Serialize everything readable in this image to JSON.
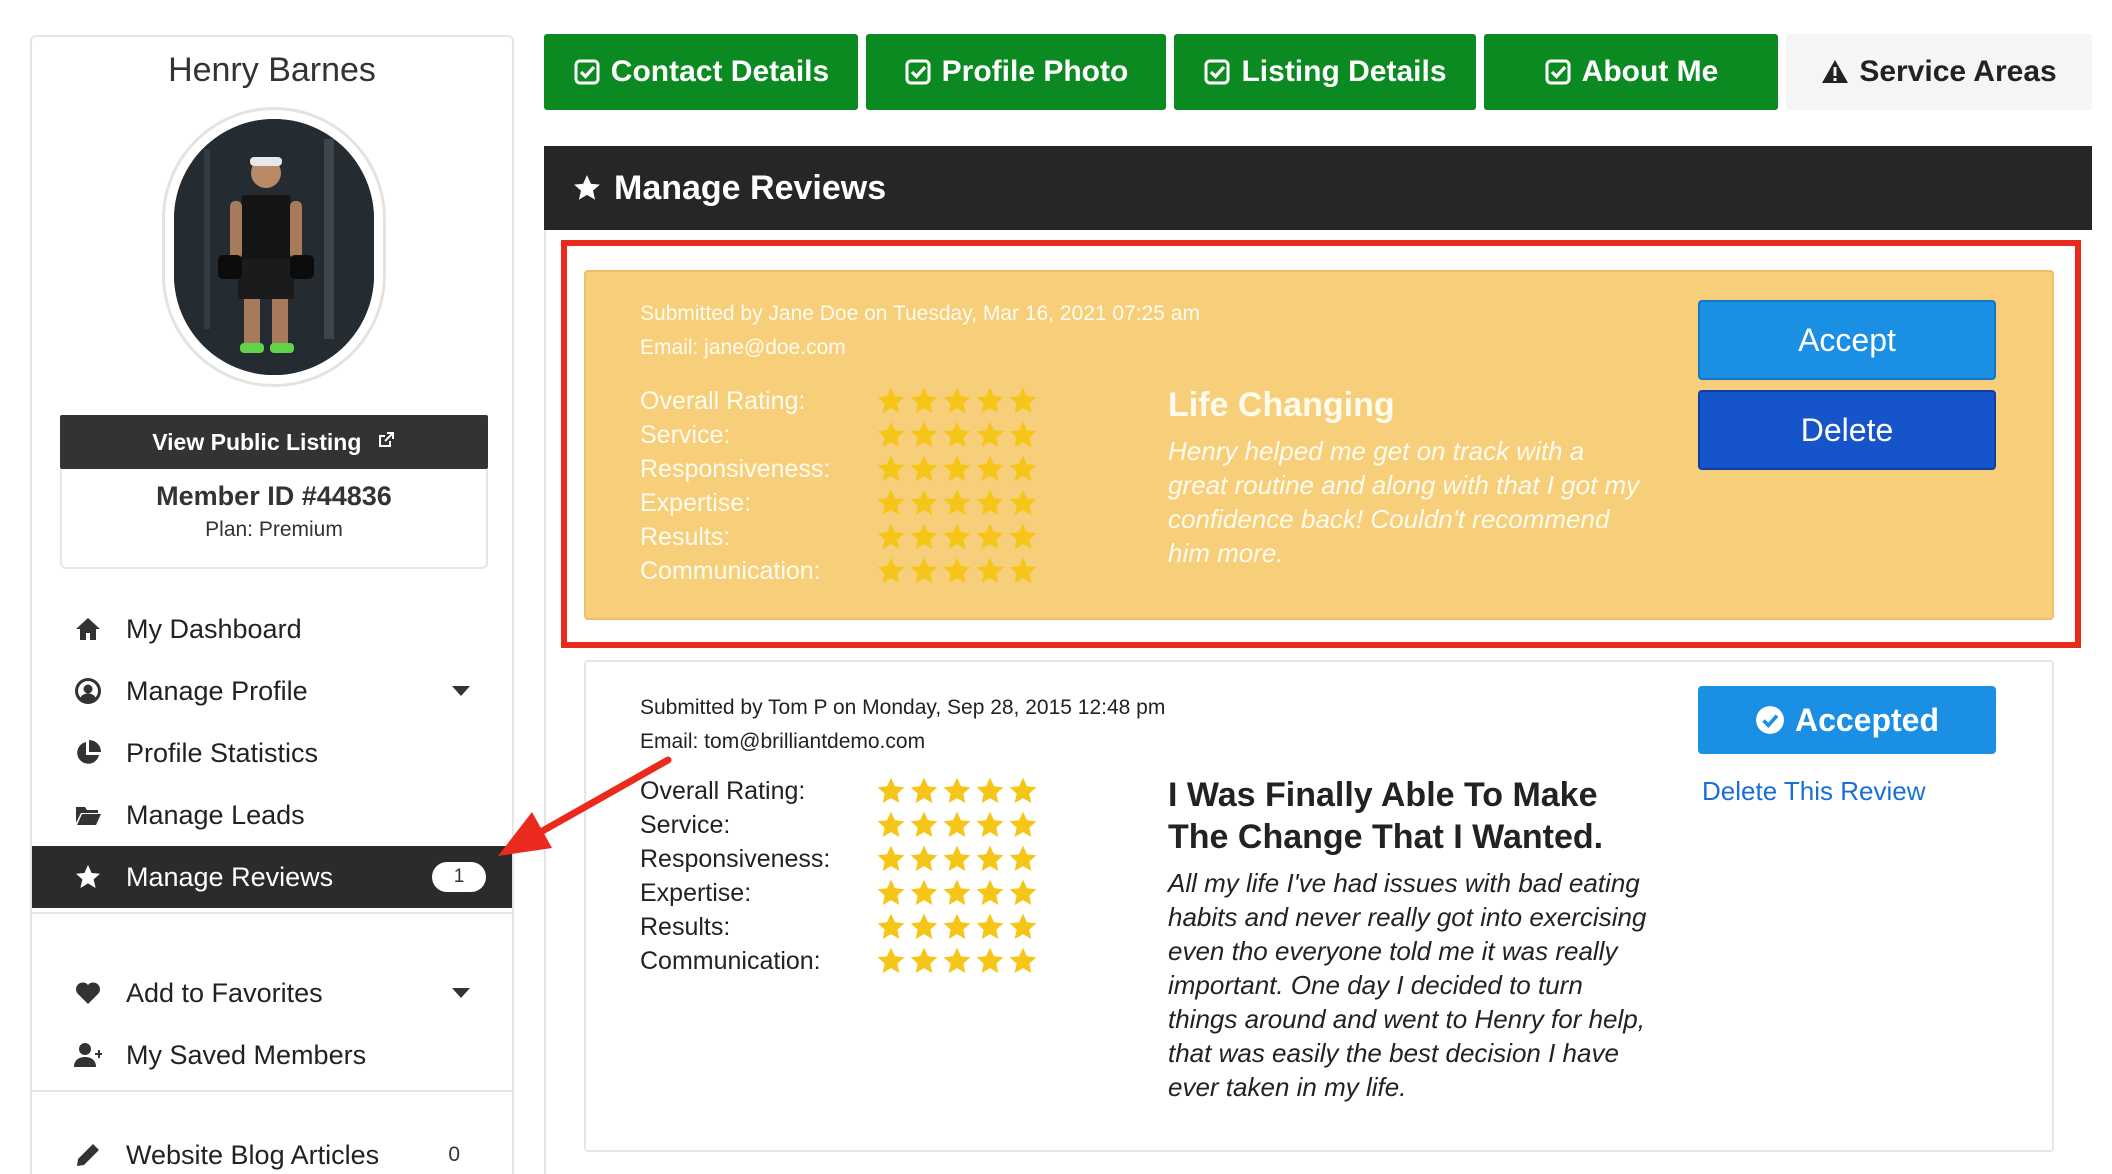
{
  "sidebar": {
    "member_name": "Henry Barnes",
    "view_public_label": "View Public Listing",
    "member_id": "Member ID #44836",
    "plan": "Plan: Premium",
    "nav": [
      {
        "label": "My Dashboard",
        "icon": "home-icon"
      },
      {
        "label": "Manage Profile",
        "icon": "user-circle-icon",
        "dropdown": true
      },
      {
        "label": "Profile Statistics",
        "icon": "pie-chart-icon"
      },
      {
        "label": "Manage Leads",
        "icon": "folder-open-icon"
      },
      {
        "label": "Manage Reviews",
        "icon": "star-icon",
        "badge": "1",
        "active": true
      },
      {
        "label": "Add to Favorites",
        "icon": "heart-icon",
        "dropdown": true
      },
      {
        "label": "My Saved Members",
        "icon": "user-plus-icon"
      },
      {
        "label": "Website Blog Articles",
        "icon": "pencil-icon",
        "count": "0"
      }
    ]
  },
  "tabs": [
    {
      "label": "Contact Details",
      "icon": "check-square-icon",
      "status": "complete"
    },
    {
      "label": "Profile Photo",
      "icon": "check-square-icon",
      "status": "complete"
    },
    {
      "label": "Listing Details",
      "icon": "check-square-icon",
      "status": "complete"
    },
    {
      "label": "About Me",
      "icon": "check-square-icon",
      "status": "complete"
    },
    {
      "label": "Service Areas",
      "icon": "warning-icon",
      "status": "incomplete"
    }
  ],
  "panel": {
    "title": "Manage Reviews"
  },
  "reviews": [
    {
      "status": "pending",
      "submitted": "Submitted by Jane Doe on Tuesday, Mar 16, 2021 07:25 am",
      "email": "Email: jane@doe.com",
      "ratings": [
        {
          "label": "Overall Rating:",
          "stars": 5
        },
        {
          "label": "Service:",
          "stars": 5
        },
        {
          "label": "Responsiveness:",
          "stars": 5
        },
        {
          "label": "Expertise:",
          "stars": 5
        },
        {
          "label": "Results:",
          "stars": 5
        },
        {
          "label": "Communication:",
          "stars": 5
        }
      ],
      "title": "Life Changing",
      "body": "Henry helped me get on track with a great routine and along with that I got my confidence back! Couldn't recommend him more.",
      "accept_label": "Accept",
      "delete_label": "Delete"
    },
    {
      "status": "accepted",
      "submitted": "Submitted by Tom P on Monday, Sep 28, 2015 12:48 pm",
      "email": "Email: tom@brilliantdemo.com",
      "ratings": [
        {
          "label": "Overall Rating:",
          "stars": 5
        },
        {
          "label": "Service:",
          "stars": 5
        },
        {
          "label": "Responsiveness:",
          "stars": 5
        },
        {
          "label": "Expertise:",
          "stars": 5
        },
        {
          "label": "Results:",
          "stars": 5
        },
        {
          "label": "Communication:",
          "stars": 5
        }
      ],
      "title": "I Was Finally Able To Make The Change That I Wanted.",
      "body": "All my life I've had issues with bad eating habits and never really got into exercising even tho everyone told me it was really important. One day I decided to turn things around and went to Henry for help, that was easily the best decision I have ever taken in my life.",
      "accepted_label": "Accepted",
      "delete_link": "Delete This Review"
    }
  ],
  "colors": {
    "tab_complete": "#0b8a22",
    "pending_review_bg": "#f7cf7a",
    "highlight_frame": "#ea2a1c",
    "star": "#f5c518",
    "accept_button": "#1a8fe3",
    "delete_button": "#1654cc"
  }
}
